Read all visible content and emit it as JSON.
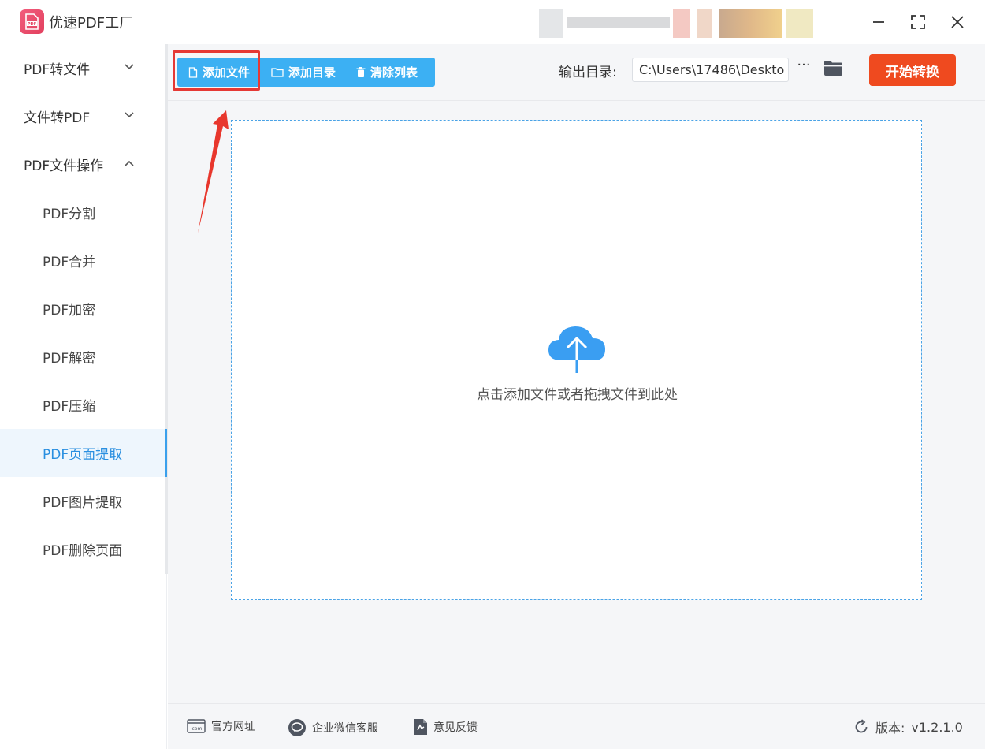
{
  "app": {
    "title": "优速PDF工厂"
  },
  "sidebar": {
    "groups": [
      {
        "label": "PDF转文件"
      },
      {
        "label": "文件转PDF"
      },
      {
        "label": "PDF文件操作"
      }
    ],
    "items": [
      {
        "label": "PDF分割"
      },
      {
        "label": "PDF合并"
      },
      {
        "label": "PDF加密"
      },
      {
        "label": "PDF解密"
      },
      {
        "label": "PDF压缩"
      },
      {
        "label": "PDF页面提取"
      },
      {
        "label": "PDF图片提取"
      },
      {
        "label": "PDF删除页面"
      }
    ],
    "active_item": "PDF页面提取"
  },
  "toolbar": {
    "add_file": "添加文件",
    "add_folder": "添加目录",
    "clear_list": "清除列表",
    "output_label": "输出目录:",
    "output_path": "C:\\Users\\17486\\Deskto",
    "more": "···",
    "start": "开始转换"
  },
  "dropzone": {
    "hint": "点击添加文件或者拖拽文件到此处"
  },
  "footer": {
    "website": "官方网址",
    "wechat": "企业微信客服",
    "feedback": "意见反馈",
    "version_label": "版本:",
    "version": "v1.2.1.0"
  },
  "colors": {
    "accent": "#3cb0f3",
    "start_button": "#ef4a1f",
    "highlight": "#e53935",
    "active_nav": "#2a8fe0"
  }
}
